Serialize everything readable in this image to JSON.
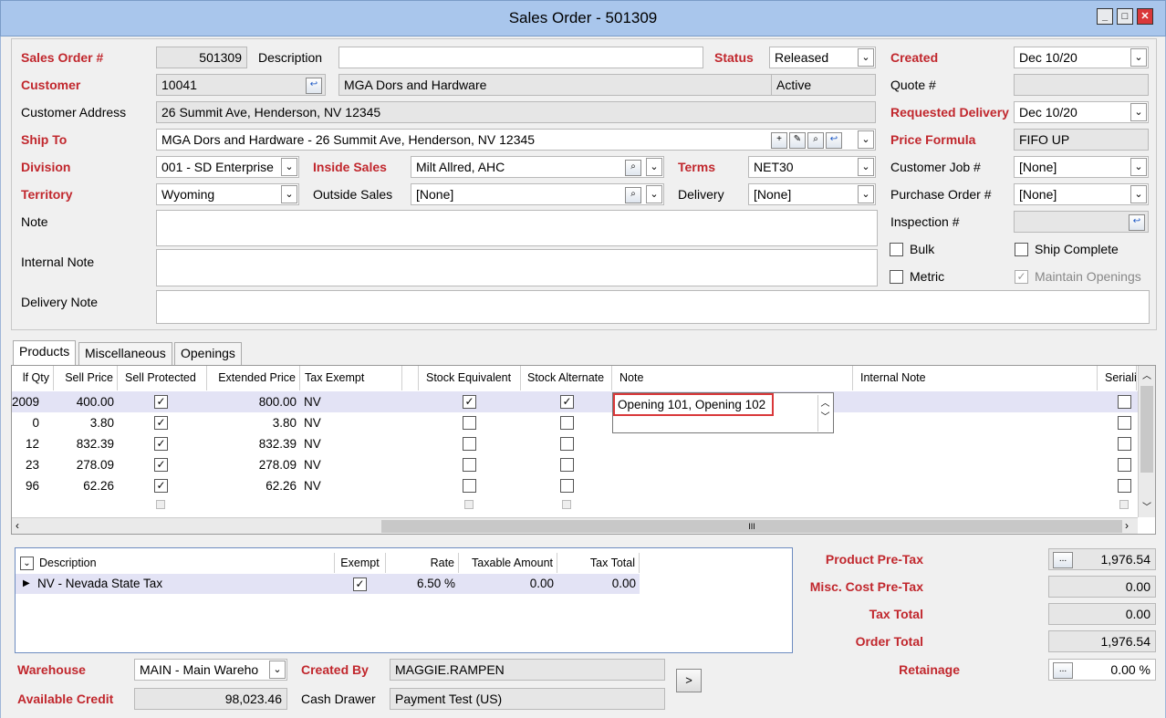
{
  "window": {
    "title": "Sales Order - 501309"
  },
  "header": {
    "so_label": "Sales Order #",
    "so_value": "501309",
    "desc_label": "Description",
    "desc_value": "",
    "status_label": "Status",
    "status_value": "Released",
    "created_label": "Created",
    "created_value": "Dec 10/20",
    "customer_label": "Customer",
    "customer_id": "10041",
    "customer_name": "MGA Dors and Hardware",
    "customer_state": "Active",
    "quote_label": "Quote #",
    "quote_value": "",
    "address_label": "Customer Address",
    "address_value": "26 Summit Ave, Henderson, NV  12345",
    "reqdel_label": "Requested Delivery",
    "reqdel_value": "Dec 10/20",
    "shipto_label": "Ship To",
    "shipto_value": "MGA Dors and Hardware - 26 Summit Ave, Henderson, NV  12345",
    "price_formula_label": "Price Formula",
    "price_formula_value": "FIFO UP",
    "division_label": "Division",
    "division_value": "001 - SD Enterprise",
    "inside_sales_label": "Inside Sales",
    "inside_sales_value": "Milt Allred, AHC",
    "terms_label": "Terms",
    "terms_value": "NET30",
    "custjob_label": "Customer Job #",
    "custjob_value": "[None]",
    "territory_label": "Territory",
    "territory_value": "Wyoming",
    "outside_sales_label": "Outside Sales",
    "outside_sales_value": "[None]",
    "delivery_label": "Delivery",
    "delivery_value": "[None]",
    "po_label": "Purchase Order #",
    "po_value": "[None]",
    "note_label": "Note",
    "inspection_label": "Inspection #",
    "internal_note_label": "Internal Note",
    "delivery_note_label": "Delivery Note",
    "bulk_label": "Bulk",
    "ship_complete_label": "Ship Complete",
    "metric_label": "Metric",
    "maintain_openings_label": "Maintain Openings"
  },
  "tabs": [
    "Products",
    "Miscellaneous",
    "Openings"
  ],
  "grid": {
    "columns": [
      "lf Qty",
      "Sell Price",
      "Sell Protected",
      "Extended Price",
      "Tax Exempt",
      "Stock Equivalent",
      "Stock Alternate",
      "Note",
      "Internal Note",
      "Serializ"
    ],
    "rows": [
      {
        "qty": "2009",
        "price": "400.00",
        "ext": "800.00",
        "tax": "NV",
        "se": true,
        "sa": true
      },
      {
        "qty": "0",
        "price": "3.80",
        "ext": "3.80",
        "tax": "NV",
        "se": false,
        "sa": false
      },
      {
        "qty": "12",
        "price": "832.39",
        "ext": "832.39",
        "tax": "NV",
        "se": false,
        "sa": false
      },
      {
        "qty": "23",
        "price": "278.09",
        "ext": "278.09",
        "tax": "NV",
        "se": false,
        "sa": false
      },
      {
        "qty": "96",
        "price": "62.26",
        "ext": "62.26",
        "tax": "NV",
        "se": false,
        "sa": false
      }
    ],
    "note_editor_value": "Opening 101, Opening 102",
    "hscroll_grip": "III"
  },
  "tax_table": {
    "columns": [
      "Description",
      "Exempt",
      "Rate",
      "Taxable Amount",
      "Tax Total"
    ],
    "row": {
      "desc": "NV - Nevada State Tax",
      "rate": "6.50 %",
      "taxable": "0.00",
      "total": "0.00"
    }
  },
  "totals": {
    "product_pretax_label": "Product Pre-Tax",
    "product_pretax": "1,976.54",
    "misc_pretax_label": "Misc. Cost Pre-Tax",
    "misc_pretax": "0.00",
    "tax_total_label": "Tax Total",
    "tax_total": "0.00",
    "order_total_label": "Order Total",
    "order_total": "1,976.54",
    "retainage_label": "Retainage",
    "retainage": "0.00 %",
    "ellipsis": "..."
  },
  "footer": {
    "warehouse_label": "Warehouse",
    "warehouse_value": "MAIN - Main Wareho",
    "created_by_label": "Created By",
    "created_by_value": "MAGGIE.RAMPEN",
    "credit_label": "Available Credit",
    "credit_value": "98,023.46",
    "cash_drawer_label": "Cash Drawer",
    "cash_drawer_value": "Payment Test (US)",
    "next_button": ">"
  },
  "colors": {
    "required_label": "#c1272d",
    "titlebar": "#a9c6ec",
    "selected_row": "#e3e3f5",
    "highlight_box": "#d9383a"
  }
}
